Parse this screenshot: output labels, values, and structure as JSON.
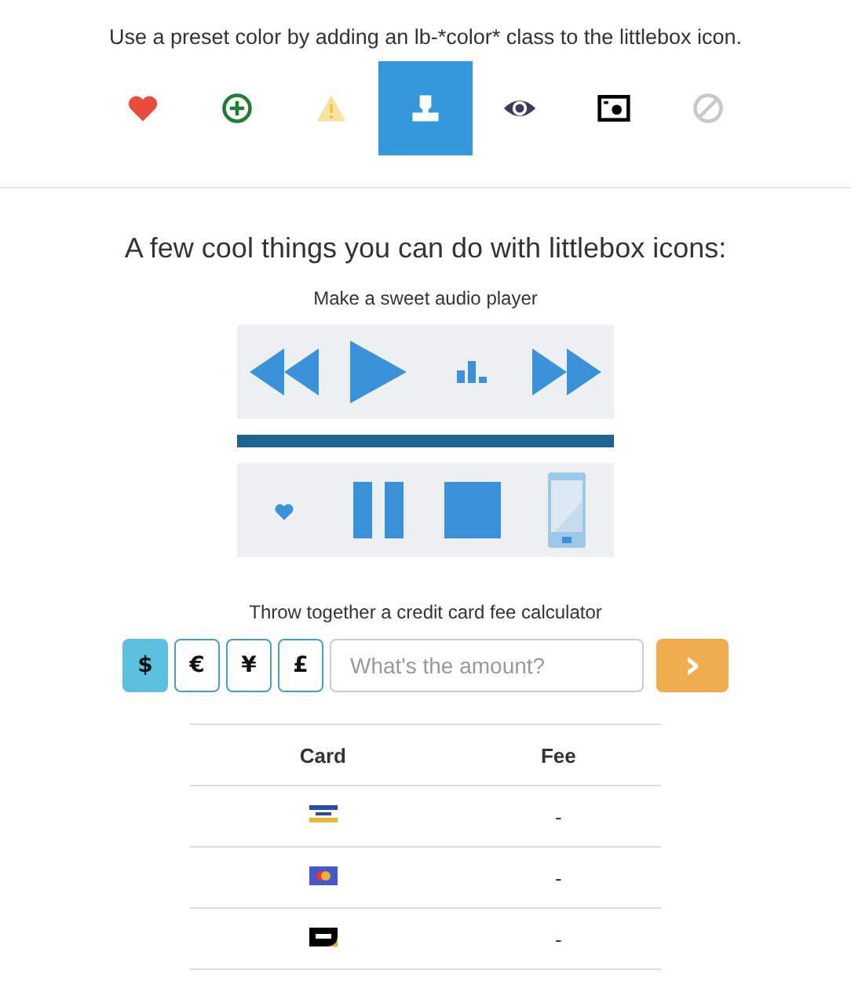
{
  "intro": "Use a preset color by adding an lb-*color* class to the littlebox icon.",
  "preset_icons": [
    {
      "kind": "heart",
      "selected": false
    },
    {
      "kind": "plus",
      "selected": false
    },
    {
      "kind": "warning",
      "selected": false
    },
    {
      "kind": "user",
      "selected": true
    },
    {
      "kind": "eye",
      "selected": false
    },
    {
      "kind": "camera",
      "selected": false
    },
    {
      "kind": "ban",
      "selected": false
    }
  ],
  "heading": "A few cool things you can do with littlebox icons:",
  "player": {
    "caption": "Make a sweet audio player",
    "top": [
      {
        "kind": "rewind"
      },
      {
        "kind": "play"
      },
      {
        "kind": "bars"
      },
      {
        "kind": "forward"
      }
    ],
    "bottom": [
      {
        "kind": "heart"
      },
      {
        "kind": "pause"
      },
      {
        "kind": "stop"
      },
      {
        "kind": "phone"
      }
    ]
  },
  "calculator": {
    "caption": "Throw together a credit card fee calculator",
    "currencies": [
      {
        "label": "$",
        "selected": true
      },
      {
        "label": "€",
        "selected": false
      },
      {
        "label": "¥",
        "selected": false
      },
      {
        "label": "£",
        "selected": false
      }
    ],
    "amount": {
      "placeholder": "What's the amount?"
    },
    "submit": "›"
  },
  "table": {
    "columns": [
      "Card",
      "Fee"
    ],
    "rows": [
      {
        "kind": "visa",
        "fee": "-"
      },
      {
        "kind": "mastercard",
        "fee": "-"
      },
      {
        "kind": "discover",
        "fee": "-"
      }
    ]
  }
}
